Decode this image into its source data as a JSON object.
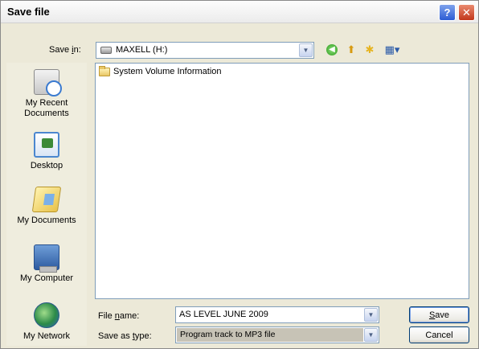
{
  "window": {
    "title": "Save file",
    "help_glyph": "?",
    "close_glyph": "✕"
  },
  "save_in": {
    "label": "Save in:",
    "label_underline_letter": "i",
    "value": "MAXELL (H:)"
  },
  "toolbar": {
    "icons": [
      "back-icon",
      "up-folder-icon",
      "new-folder-icon",
      "views-menu-icon"
    ]
  },
  "places": [
    {
      "label_lines": [
        "My Recent",
        "Documents"
      ],
      "icon": "recent-documents-icon"
    },
    {
      "label_lines": [
        "Desktop"
      ],
      "icon": "desktop-icon"
    },
    {
      "label_lines": [
        "My Documents"
      ],
      "icon": "my-documents-icon"
    },
    {
      "label_lines": [
        "My Computer"
      ],
      "icon": "my-computer-icon"
    },
    {
      "label_lines": [
        "My Network"
      ],
      "icon": "my-network-icon"
    }
  ],
  "file_list": {
    "items": [
      {
        "name": "System Volume Information",
        "type": "folder"
      }
    ]
  },
  "file_name": {
    "label_pre": "File ",
    "label_u": "n",
    "label_post": "ame:",
    "value": "AS LEVEL JUNE 2009"
  },
  "save_as_type": {
    "label_pre": "Save as ",
    "label_u": "t",
    "label_post": "ype:",
    "value": "Program track to MP3 file"
  },
  "buttons": {
    "save_u": "S",
    "save_rest": "ave",
    "cancel": "Cancel"
  }
}
